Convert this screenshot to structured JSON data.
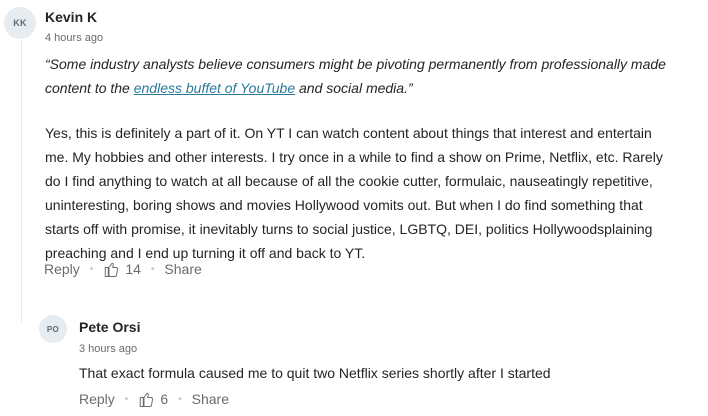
{
  "comments": [
    {
      "initials": "KK",
      "name": "Kevin K",
      "time": "4 hours ago",
      "quote_before": "“Some industry analysts believe consumers might be pivoting permanently from professionally made content to the ",
      "quote_link": "endless buffet of YouTube",
      "quote_after": " and social media.”",
      "body_lines": [
        "Yes, this is definitely a part of it. On YT I can watch content about things that interest and entertain",
        "me.  My hobbies and other interests. I try once in a while to find a show on Prime, Netflix, etc. Rarely",
        "do I find anything to watch at all because of all the cookie cutter, formulaic, nauseatingly repetitive,",
        "uninteresting, boring shows and movies Hollywood vomits out. But when I do find something that",
        "starts off with promise, it inevitably turns to social justice, LGBTQ, DEI, politics Hollywoodsplaining",
        "preaching and I end up turning it off and back to YT."
      ],
      "reply_label": "Reply",
      "claps": "14",
      "share_label": "Share"
    },
    {
      "initials": "PO",
      "name": "Pete Orsi",
      "time": "3 hours ago",
      "body": "That exact formula caused me to quit two Netflix series shortly after I started",
      "reply_label": "Reply",
      "claps": "6",
      "share_label": "Share"
    }
  ]
}
